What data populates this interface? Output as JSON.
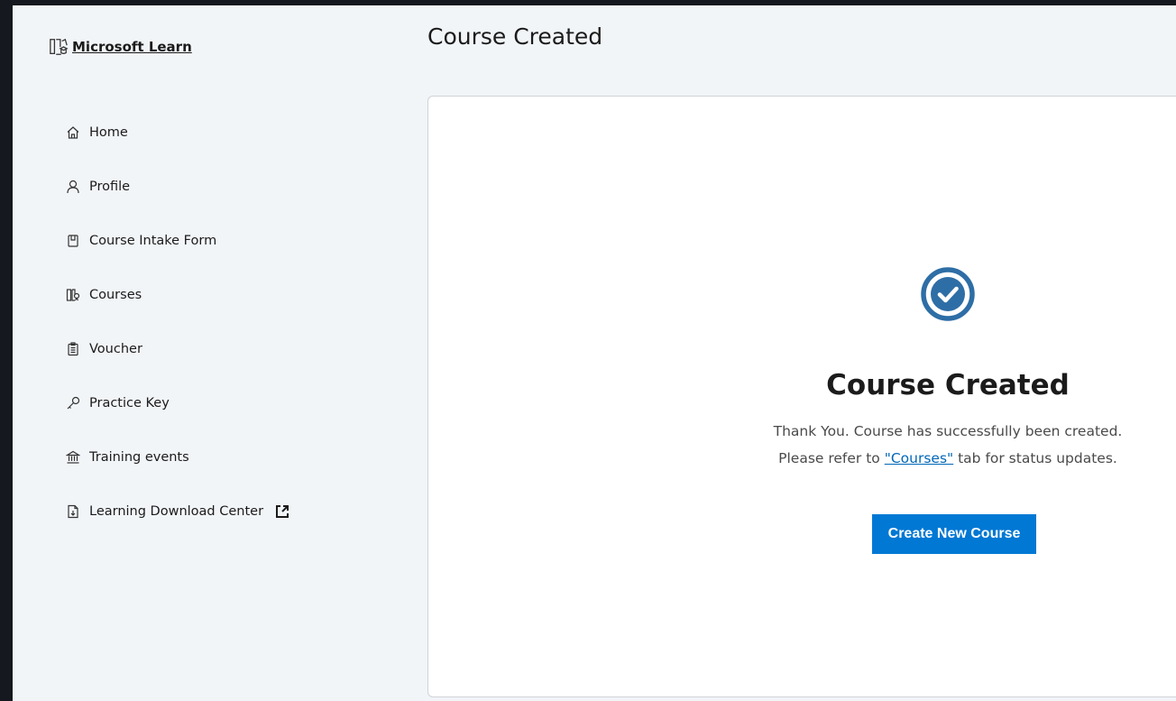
{
  "sidebar": {
    "brand_label": "Microsoft Learn",
    "items": [
      {
        "label": "Home",
        "icon": "home-icon"
      },
      {
        "label": "Profile",
        "icon": "person-icon"
      },
      {
        "label": "Course Intake Form",
        "icon": "form-icon"
      },
      {
        "label": "Courses",
        "icon": "courses-icon"
      },
      {
        "label": "Voucher",
        "icon": "voucher-icon"
      },
      {
        "label": "Practice Key",
        "icon": "key-icon"
      },
      {
        "label": "Training events",
        "icon": "institution-icon"
      },
      {
        "label": "Learning Download Center",
        "icon": "download-document-icon",
        "external_icon": "external-link-icon"
      }
    ]
  },
  "main": {
    "page_title": "Course Created",
    "card": {
      "icon": "check-circle-icon",
      "title": "Course Created",
      "message_line1": "Thank You. Course has successfully been created.",
      "message_line2_prefix": "Please refer to ",
      "message_line2_link": "\"Courses\"",
      "message_line2_suffix": " tab for status updates.",
      "button_label": "Create New Course"
    }
  },
  "colors": {
    "accent": "#0078d4",
    "check_icon": "#2e6ea6",
    "sidebar_bg": "#f2f5f8",
    "frame_bg": "#15181e"
  }
}
